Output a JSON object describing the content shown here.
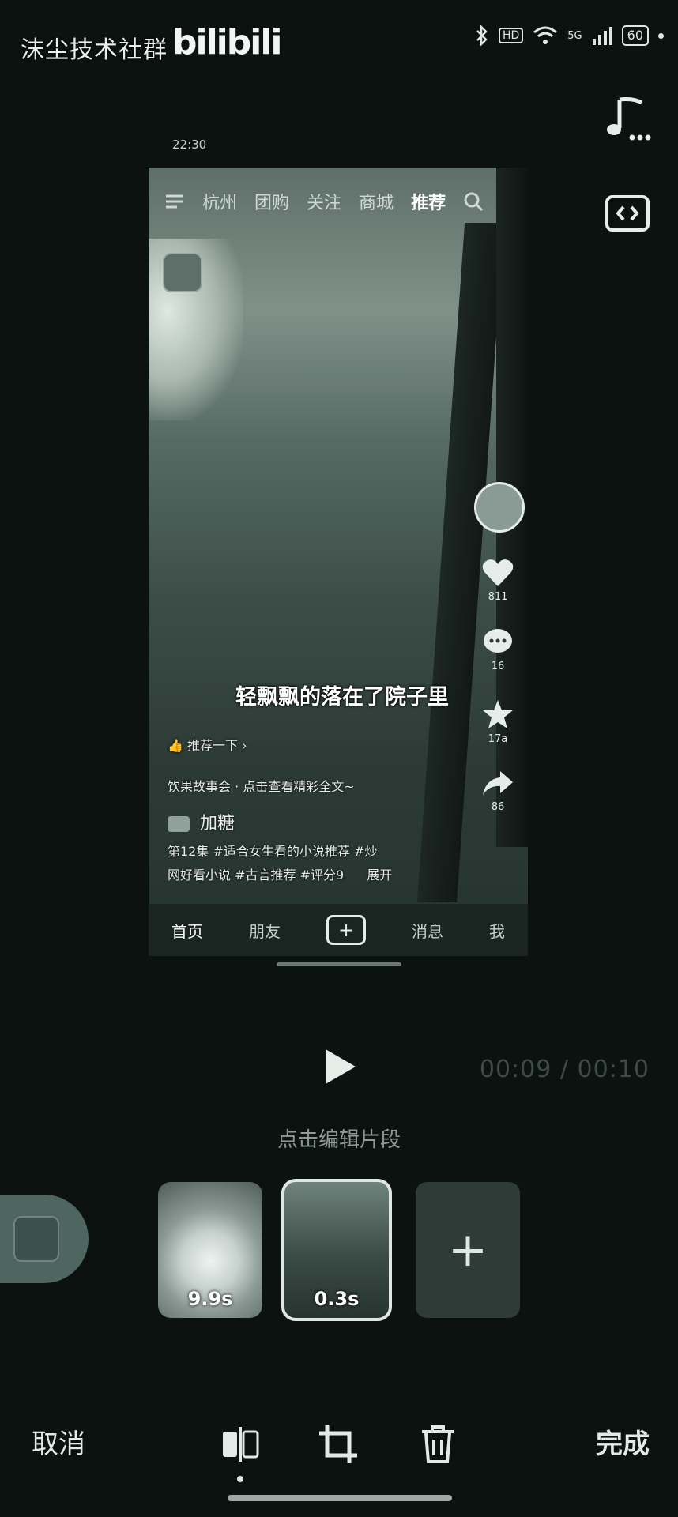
{
  "status_bar": {
    "watermark": "沫尘技术社群",
    "logo": "bilibili",
    "network": "HD",
    "signal": "5G",
    "battery": "60"
  },
  "tools": {
    "music_icon": "music-note-icon",
    "code_icon": "code-box-icon"
  },
  "preview": {
    "time": "22:30",
    "nav": [
      "杭州",
      "团购",
      "关注",
      "商城",
      "推荐"
    ],
    "stats": {
      "likes": "811",
      "comments": "16",
      "favorites": "17a",
      "shares": "86"
    },
    "subtitle": "轻飘飘的落在了院子里",
    "recommend": "推荐一下",
    "author_line": "饮果故事会 · 点击查看精彩全文~",
    "follow": "加糖",
    "tags_line1": "第12集 #适合女生看的小说推荐 #炒",
    "tags_line2": "网好看小说 #古言推荐 #评分9",
    "expand": "展开",
    "tabbar": [
      "首页",
      "朋友",
      "+",
      "消息",
      "我"
    ]
  },
  "playback": {
    "current": "00:09",
    "separator": "/",
    "total": "00:10",
    "hint": "点击编辑片段"
  },
  "clips": [
    {
      "duration": "9.9s"
    },
    {
      "duration": "0.3s"
    }
  ],
  "toolbar": {
    "cancel": "取消",
    "done": "完成"
  }
}
